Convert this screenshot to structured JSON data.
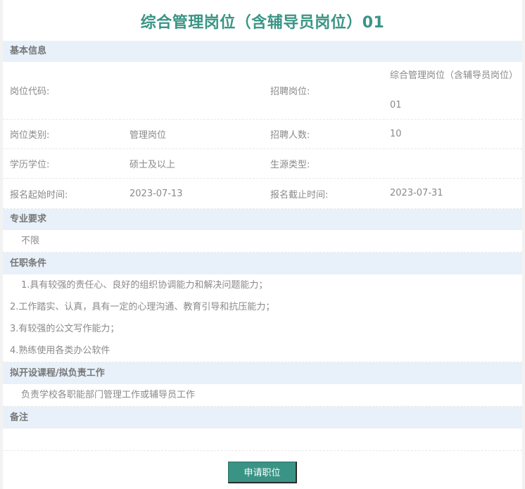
{
  "title": "综合管理岗位（含辅导员岗位）01",
  "sections": {
    "basic": "基本信息",
    "major": "专业要求",
    "requirements": "任职条件",
    "courses": "拟开设课程/拟负责工作",
    "remarks": "备注"
  },
  "basic_info": {
    "position_code_label": "岗位代码:",
    "position_code_value": "",
    "recruit_position_label": "招聘岗位:",
    "recruit_position_value": "综合管理岗位（含辅导员岗位）01",
    "category_label": "岗位类别:",
    "category_value": "管理岗位",
    "headcount_label": "招聘人数:",
    "headcount_value": "10",
    "degree_label": "学历学位:",
    "degree_value": "硕士及以上",
    "source_label": "生源类型:",
    "source_value": "",
    "start_label": "报名起始时间:",
    "start_value": "2023-07-13",
    "end_label": "报名截止时间:",
    "end_value": "2023-07-31"
  },
  "major_requirement": "不限",
  "requirements": [
    "1.具有较强的责任心、良好的组织协调能力和解决问题能力；",
    "2.工作踏实、认真，具有一定的心理沟通、教育引导和抗压能力；",
    "3.有较强的公文写作能力；",
    "4.熟练使用各类办公软件"
  ],
  "courses_text": "负责学校各职能部门管理工作或辅导员工作",
  "remarks_text": "",
  "apply_button": "申请职位"
}
